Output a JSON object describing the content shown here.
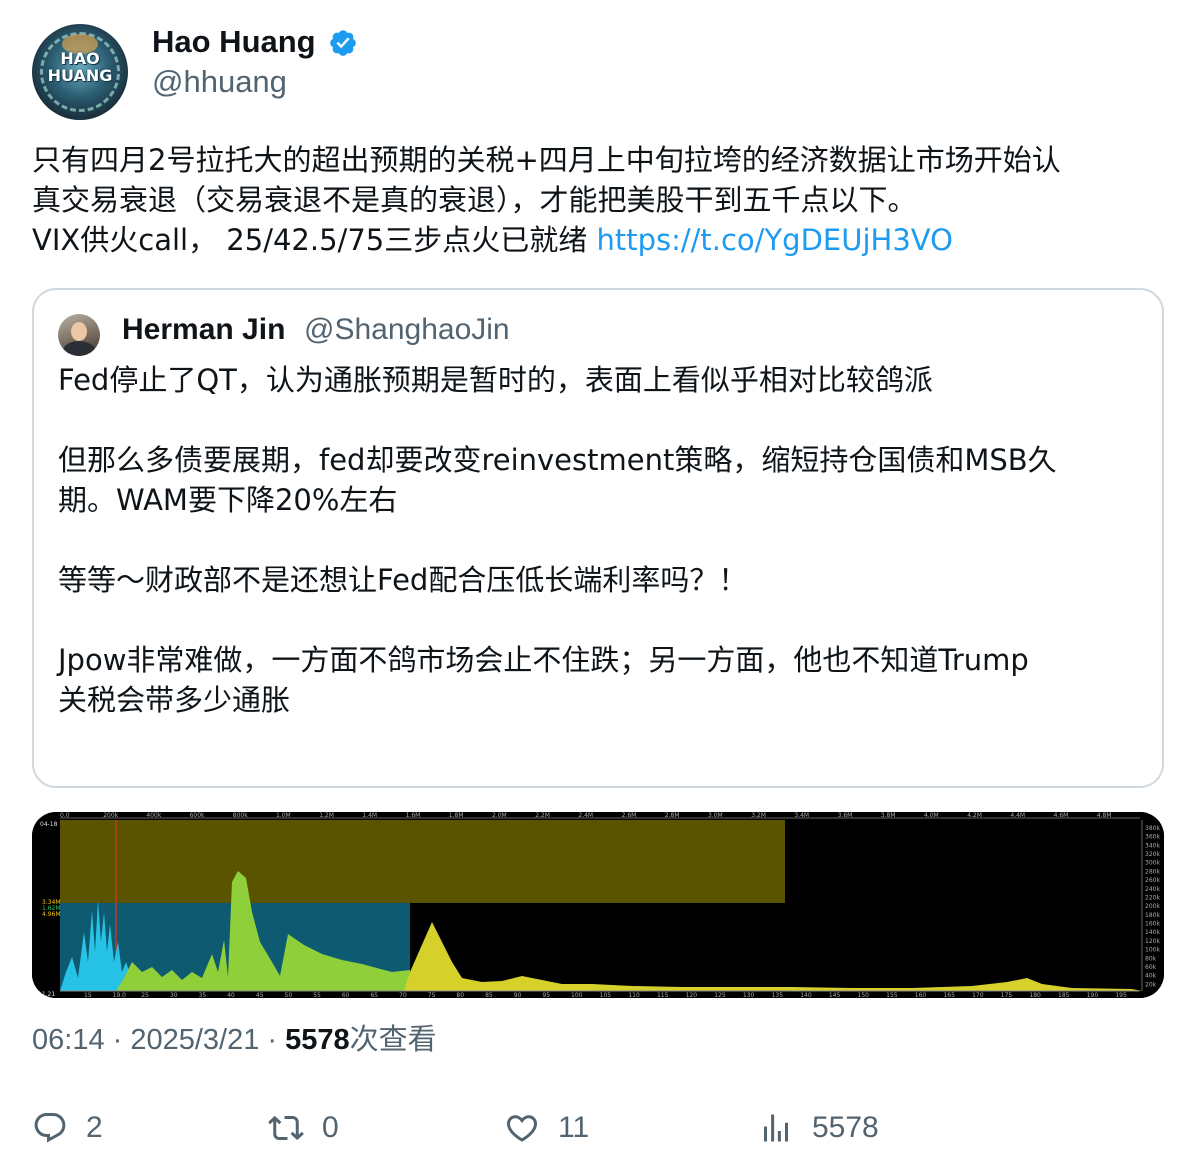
{
  "tweet": {
    "author": {
      "name": "Hao Huang",
      "handle": "@hhuang",
      "avatar_text": "HAO HUANG",
      "verified": true
    },
    "text_lines": [
      "只有四月2号拉托大的超出预期的关税+四月上中旬拉垮的经济数据让市场开始认",
      "真交易衰退（交易衰退不是真的衰退），才能把美股干到五千点以下。",
      "VIX供火call， 25/42.5/75三步点火已就绪 "
    ],
    "link": "https://t.co/YgDEUjH3VO",
    "quote": {
      "author": {
        "name": "Herman Jin",
        "handle": "@ShanghaoJin"
      },
      "text": "Fed停止了QT，认为通胀预期是暂时的，表面上看似乎相对比较鸽派\n\n但那么多债要展期，fed却要改变reinvestment策略，缩短持仓国债和MSB久\n期。WAM要下降20%左右\n\n等等～财政部不是还想让Fed配合压低长端利率吗？！\n\nJpow非常难做，一方面不鸽市场会止不住跌；另一方面，他也不知道Trump\n关税会带多少通胀"
    },
    "media": {
      "description_icon": "chart-image",
      "left_labels": [
        "3.34M",
        "1.62M",
        "4.96M"
      ],
      "top_left_label": "04-18",
      "bottom_left_label": "$1.21",
      "top_axis": [
        "0.0",
        "200k",
        "400k",
        "600k",
        "800k",
        "1.0M",
        "1.2M",
        "1.4M",
        "1.6M",
        "1.8M",
        "2.0M",
        "2.2M",
        "2.4M",
        "2.6M",
        "2.8M",
        "3.0M",
        "3.2M",
        "3.4M",
        "3.6M",
        "3.8M",
        "4.0M",
        "4.2M",
        "4.4M",
        "4.6M",
        "4.8M"
      ],
      "bottom_axis": [
        "15",
        "19.0",
        "25",
        "30",
        "35",
        "40",
        "45",
        "50",
        "55",
        "60",
        "65",
        "70",
        "75",
        "80",
        "85",
        "90",
        "95",
        "100",
        "105",
        "110",
        "115",
        "120",
        "125",
        "130",
        "135",
        "140",
        "145",
        "150",
        "155",
        "160",
        "165",
        "170",
        "175",
        "180",
        "185",
        "190",
        "195"
      ],
      "right_axis": [
        "380k",
        "360k",
        "340k",
        "320k",
        "300k",
        "280k",
        "260k",
        "240k",
        "220k",
        "200k",
        "180k",
        "160k",
        "140k",
        "120k",
        "100k",
        "80k",
        "60k",
        "40k",
        "20k"
      ]
    },
    "timestamp": "06:14 · 2025/3/21 · ",
    "views_count": "5578",
    "views_label": "次查看",
    "actions": {
      "reply": {
        "icon": "reply-icon",
        "count": "2"
      },
      "retweet": {
        "icon": "retweet-icon",
        "count": "0"
      },
      "like": {
        "icon": "heart-icon",
        "count": "11"
      },
      "views": {
        "icon": "analytics-icon",
        "count": "5578"
      }
    },
    "colors": {
      "link": "#1d9bf0",
      "verified": "#1d9bf0",
      "muted": "#536471",
      "border": "#cfd9de"
    }
  }
}
